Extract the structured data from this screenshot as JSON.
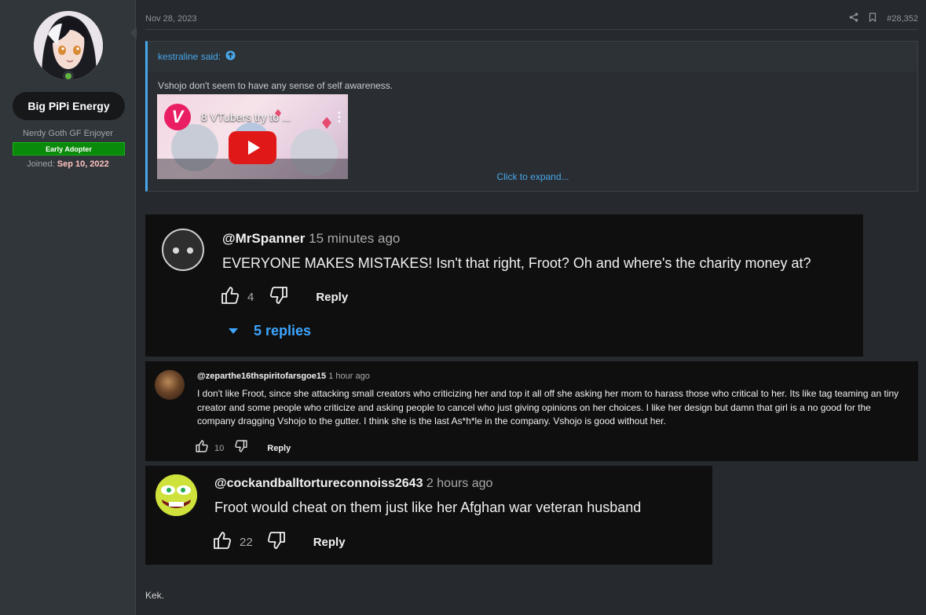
{
  "user": {
    "username": "Big PiPi Energy",
    "title": "Nerdy Goth GF Enjoyer",
    "badge": "Early Adopter",
    "joined_label": "Joined:",
    "joined_date": "Sep 10, 2022",
    "avatar_icon": "anime-avatar",
    "online_icon": "online-status-icon"
  },
  "post": {
    "date": "Nov 28, 2023",
    "number": "#28,352",
    "share_icon": "share-icon",
    "bookmark_icon": "bookmark-icon",
    "quote": {
      "author_said": "kestraline said:",
      "text": "Vshojo don't seem to have any sense of self awareness.",
      "video_title": "8 VTubers try to ...",
      "expand_label": "Click to expand..."
    },
    "closing_text": "Kek."
  },
  "comments": [
    {
      "handle": "@MrSpanner",
      "time": "15 minutes ago",
      "text": "EVERYONE MAKES MISTAKES! Isn't that right, Froot? Oh and where's the charity money at?",
      "likes": "4",
      "reply_label": "Reply",
      "replies_label": "5 replies"
    },
    {
      "handle": "@zeparthe16thspiritofarsgoe15",
      "time": "1 hour ago",
      "text": "I don't like Froot, since she attacking small creators who criticizing her and top it all off she asking her mom to harass those who critical to her. Its like tag teaming an tiny creator and some people who criticize and asking people to cancel who just giving opinions on her choices. I like her design but damn that girl is a no good for the company dragging Vshojo to the gutter. I think she is the last As*h*le in the company. Vshojo is good without her.",
      "likes": "10",
      "reply_label": "Reply"
    },
    {
      "handle": "@cockandballtortureconnoiss2643",
      "time": "2 hours ago",
      "text": "Froot would cheat on them just like her Afghan war veteran husband",
      "likes": "22",
      "reply_label": "Reply"
    }
  ],
  "colors": {
    "link": "#47a7eb",
    "badge_green": "#0a8a0a",
    "joined_date": "#ffc1c1",
    "yt_red": "#e01818",
    "replies_blue": "#3ea6ff"
  }
}
